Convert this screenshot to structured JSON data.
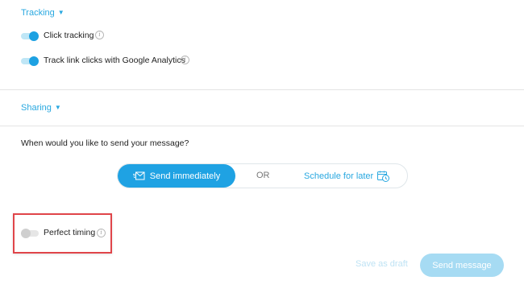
{
  "tracking": {
    "label": "Tracking",
    "items": [
      {
        "label": "Click tracking",
        "enabled": true
      },
      {
        "label": "Track link clicks with Google Analytics",
        "enabled": true
      }
    ]
  },
  "sharing": {
    "label": "Sharing"
  },
  "schedule": {
    "question": "When would you like to send your message?",
    "send_now_label": "Send immediately",
    "or_label": "OR",
    "later_label": "Schedule for later"
  },
  "perfect_timing": {
    "label": "Perfect timing",
    "enabled": false
  },
  "footer": {
    "draft_label": "Save as draft",
    "send_label": "Send message"
  },
  "colors": {
    "accent": "#1fa2e3",
    "highlight_border": "#e0454a",
    "disabled_button": "#a6dbf3"
  }
}
